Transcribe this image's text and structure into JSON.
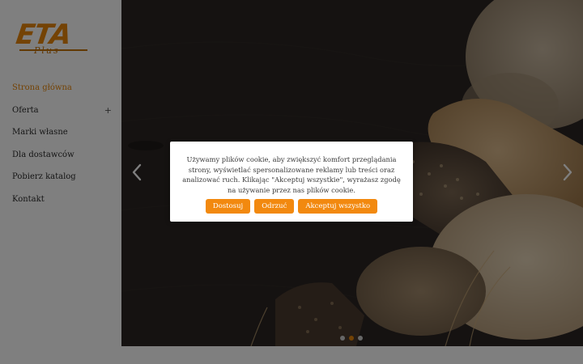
{
  "logo": {
    "brand": "ETA",
    "sub": "Plus"
  },
  "nav": {
    "items": [
      {
        "label": "Strona główna",
        "active": true,
        "has_submenu": false
      },
      {
        "label": "Oferta",
        "active": false,
        "has_submenu": true
      },
      {
        "label": "Marki własne",
        "active": false,
        "has_submenu": false
      },
      {
        "label": "Dla dostawców",
        "active": false,
        "has_submenu": false
      },
      {
        "label": "Pobierz katalog",
        "active": false,
        "has_submenu": false
      },
      {
        "label": "Kontakt",
        "active": false,
        "has_submenu": false
      }
    ],
    "submenu_symbol": "+"
  },
  "slider": {
    "slide_count": 3,
    "active_slide": 2,
    "prev_icon": "chevron-left-icon",
    "next_icon": "chevron-right-icon"
  },
  "cookie_banner": {
    "message": "Używamy plików cookie, aby zwiększyć komfort przeglądania strony, wyświetlać spersonalizowane reklamy lub treści oraz analizować ruch. Klikając \"Akceptuj wszystkie\", wyrażasz zgodę na używanie przez nas plików cookie.",
    "customize_label": "Dostosuj",
    "reject_label": "Odrzuć",
    "accept_label": "Akceptuj wszystko"
  },
  "colors": {
    "accent": "#e8860a",
    "button": "#f2890f",
    "hero_background": "#272321"
  }
}
